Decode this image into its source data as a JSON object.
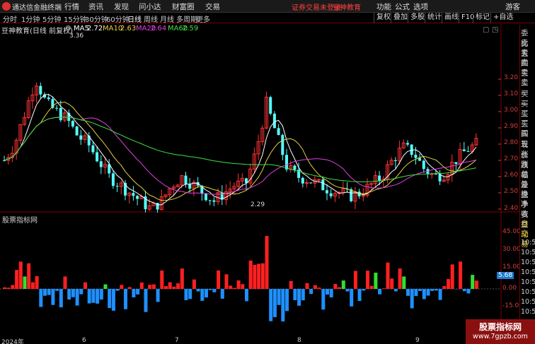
{
  "app": {
    "title": "通达信金融终端",
    "icon": "tdx-logo-icon"
  },
  "menu": {
    "items": [
      "行情",
      "资讯",
      "发现",
      "问小达",
      "财富圈",
      "交易"
    ],
    "notice": "证券交易未登录",
    "notice2": "豆神教育",
    "right": [
      "功能",
      "公式",
      "选项"
    ],
    "user": "游客"
  },
  "toolbar": {
    "periods": [
      "分时",
      "1分钟",
      "5分钟",
      "15分钟",
      "30分钟",
      "60分钟",
      "日线",
      "周线",
      "月线",
      "多周期",
      "更多"
    ],
    "active": "日线",
    "right": [
      "复权",
      "叠加",
      "多股",
      "统计",
      "画线",
      "F10",
      "标记",
      "+自选"
    ]
  },
  "main_chart": {
    "title": "豆神教育(日线 前复权)",
    "indicators": [
      {
        "name": "MA5",
        "value": "2.72",
        "color": "#ffffff"
      },
      {
        "name": "MA10",
        "value": "2.63",
        "color": "#e8d040"
      },
      {
        "name": "MA20",
        "value": "2.64",
        "color": "#e040e0"
      },
      {
        "name": "MA60",
        "value": "2.59",
        "color": "#40e040"
      }
    ],
    "high_label": "3.36",
    "low_label": "2.29",
    "yticks": [
      "3.20",
      "3.10",
      "3.00",
      "2.90",
      "2.80",
      "2.70",
      "2.60",
      "2.50",
      "2.40"
    ],
    "colors": {
      "up": "#ff3232",
      "down": "#54ffff"
    }
  },
  "sub_chart": {
    "title": "股票指标网",
    "yticks": [
      "45.00",
      "30.00",
      "15.00",
      "0.00",
      "-15.00"
    ],
    "current": "5.68",
    "colors": {
      "pos": "#ff2020",
      "neg": "#1e90ff",
      "green": "#30e030"
    }
  },
  "xaxis": {
    "labels": [
      "2024年",
      "6",
      "7",
      "8",
      "9"
    ]
  },
  "sidebar": {
    "quote_items": [
      "委比",
      "卖五",
      "卖四",
      "卖三",
      "卖二",
      "卖一",
      "买一",
      "买二",
      "买三",
      "买四",
      "买五",
      "现价",
      "涨跌",
      "涨幅",
      "总量",
      "外盘",
      "换手",
      "净资",
      "收益"
    ],
    "trade_items": [
      "自动",
      "交易"
    ],
    "times": [
      "10:54",
      "10:54",
      "10:54",
      "10:54",
      "10:54",
      "10:54",
      "10:54",
      "10:54"
    ]
  },
  "watermark": {
    "line1": "股票指标网",
    "line2": "www.7gpzb.com"
  }
}
